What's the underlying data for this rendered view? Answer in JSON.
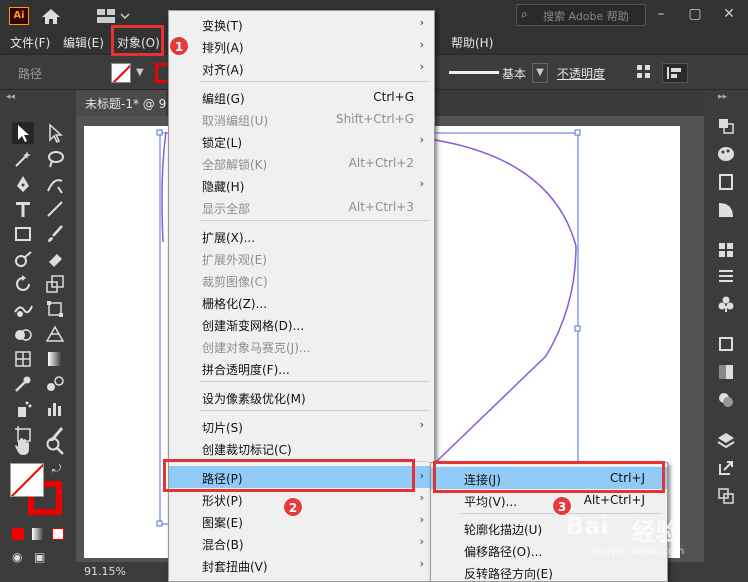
{
  "app": {
    "logo_text": "Ai",
    "search_placeholder": "搜索 Adobe 帮助",
    "search_icon": "search-icon"
  },
  "menubar": {
    "items": [
      "文件(F)",
      "编辑(E)",
      "对象(O)",
      "帮助(H)"
    ]
  },
  "control": {
    "label": "路径",
    "stroke_profile": "基本",
    "opacity_label": "不透明度"
  },
  "document": {
    "tab_title": "未标题-1* @ 9",
    "zoom": "91.15%"
  },
  "object_menu": {
    "items": [
      {
        "label": "变换(T)",
        "shortcut": "",
        "submenu": true,
        "enabled": true
      },
      {
        "label": "排列(A)",
        "shortcut": "",
        "submenu": true,
        "enabled": true
      },
      {
        "label": "对齐(A)",
        "shortcut": "",
        "submenu": true,
        "enabled": true
      },
      {
        "label": "编组(G)",
        "shortcut": "Ctrl+G",
        "submenu": false,
        "enabled": true
      },
      {
        "label": "取消编组(U)",
        "shortcut": "Shift+Ctrl+G",
        "submenu": false,
        "enabled": false
      },
      {
        "label": "锁定(L)",
        "shortcut": "",
        "submenu": true,
        "enabled": true
      },
      {
        "label": "全部解锁(K)",
        "shortcut": "Alt+Ctrl+2",
        "submenu": false,
        "enabled": false
      },
      {
        "label": "隐藏(H)",
        "shortcut": "",
        "submenu": true,
        "enabled": true
      },
      {
        "label": "显示全部",
        "shortcut": "Alt+Ctrl+3",
        "submenu": false,
        "enabled": false
      },
      {
        "label": "扩展(X)...",
        "shortcut": "",
        "submenu": false,
        "enabled": true
      },
      {
        "label": "扩展外观(E)",
        "shortcut": "",
        "submenu": false,
        "enabled": false
      },
      {
        "label": "裁剪图像(C)",
        "shortcut": "",
        "submenu": false,
        "enabled": false
      },
      {
        "label": "栅格化(Z)...",
        "shortcut": "",
        "submenu": false,
        "enabled": true
      },
      {
        "label": "创建渐变网格(D)...",
        "shortcut": "",
        "submenu": false,
        "enabled": true
      },
      {
        "label": "创建对象马赛克(J)...",
        "shortcut": "",
        "submenu": false,
        "enabled": false
      },
      {
        "label": "拼合透明度(F)...",
        "shortcut": "",
        "submenu": false,
        "enabled": true
      },
      {
        "label": "设为像素级优化(M)",
        "shortcut": "",
        "submenu": false,
        "enabled": true
      },
      {
        "label": "切片(S)",
        "shortcut": "",
        "submenu": true,
        "enabled": true
      },
      {
        "label": "创建裁切标记(C)",
        "shortcut": "",
        "submenu": false,
        "enabled": true
      },
      {
        "label": "路径(P)",
        "shortcut": "",
        "submenu": true,
        "enabled": true,
        "highlighted": true
      },
      {
        "label": "形状(P)",
        "shortcut": "",
        "submenu": true,
        "enabled": true
      },
      {
        "label": "图案(E)",
        "shortcut": "",
        "submenu": true,
        "enabled": true
      },
      {
        "label": "混合(B)",
        "shortcut": "",
        "submenu": true,
        "enabled": true
      },
      {
        "label": "封套扭曲(V)",
        "shortcut": "",
        "submenu": true,
        "enabled": true
      }
    ]
  },
  "path_submenu": {
    "items": [
      {
        "label": "连接(J)",
        "shortcut": "Ctrl+J",
        "highlighted": true
      },
      {
        "label": "平均(V)...",
        "shortcut": "Alt+Ctrl+J"
      },
      {
        "label": "轮廓化描边(U)",
        "shortcut": ""
      },
      {
        "label": "偏移路径(O)...",
        "shortcut": ""
      },
      {
        "label": "反转路径方向(E)",
        "shortcut": ""
      }
    ]
  },
  "annotations": {
    "badges": [
      "1",
      "2",
      "3"
    ]
  },
  "watermark": {
    "line1": "Bai",
    "line1b": "经验",
    "line2": "jingyan.baidu.com"
  },
  "colors": {
    "accent_red": "#e53333",
    "menu_highlight": "#91c9f7",
    "path_stroke": "#8a5bd6"
  }
}
